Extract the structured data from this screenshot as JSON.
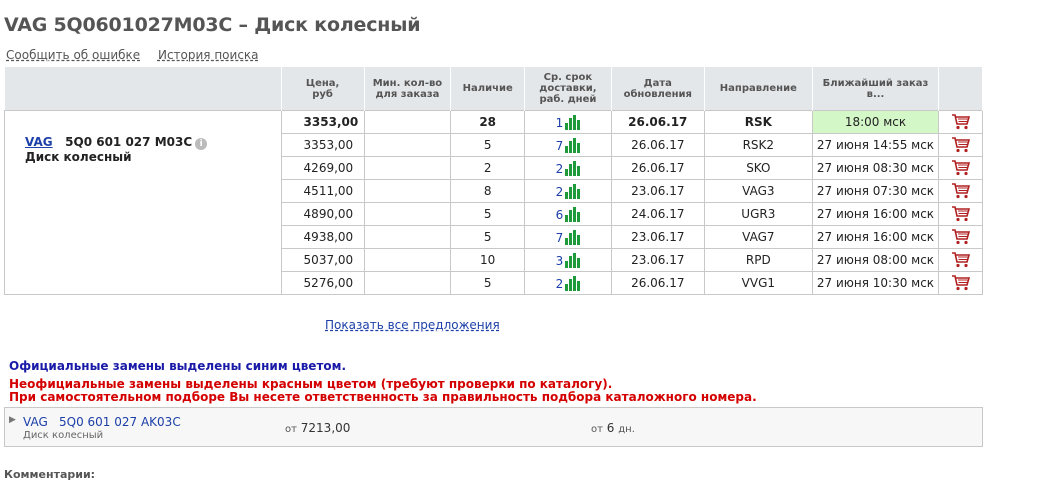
{
  "page": {
    "title": "VAG 5Q0601027M03C – Диск колесный",
    "links": [
      "Сообщить об ошибке",
      "История поиска"
    ]
  },
  "product": {
    "brand": "VAG",
    "number": "5Q0 601 027 M03C",
    "name": "Диск колесный",
    "info_icon": "i"
  },
  "table": {
    "headers": [
      "Цена,\nруб",
      "Мин. кол-во\nдля заказа",
      "Наличие",
      "Ср. срок\nдоставки,\nраб. дней",
      "Дата\nобновления",
      "Направление",
      "Ближайший заказ в..."
    ],
    "rows": [
      {
        "price": "3353,00",
        "min": "",
        "stock": "28",
        "days": "1",
        "date": "26.06.17",
        "direction": "RSK",
        "order": "18:00 мск"
      },
      {
        "price": "3353,00",
        "min": "",
        "stock": "5",
        "days": "7",
        "date": "26.06.17",
        "direction": "RSK2",
        "order": "27 июня 14:55 мск"
      },
      {
        "price": "4269,00",
        "min": "",
        "stock": "2",
        "days": "2",
        "date": "26.06.17",
        "direction": "SKO",
        "order": "27 июня 08:30 мск"
      },
      {
        "price": "4511,00",
        "min": "",
        "stock": "8",
        "days": "2",
        "date": "23.06.17",
        "direction": "VAG3",
        "order": "27 июня 07:30 мск"
      },
      {
        "price": "4890,00",
        "min": "",
        "stock": "5",
        "days": "6",
        "date": "24.06.17",
        "direction": "UGR3",
        "order": "27 июня 16:00 мск"
      },
      {
        "price": "4938,00",
        "min": "",
        "stock": "5",
        "days": "7",
        "date": "23.06.17",
        "direction": "VAG7",
        "order": "27 июня 16:00 мск"
      },
      {
        "price": "5037,00",
        "min": "",
        "stock": "10",
        "days": "3",
        "date": "23.06.17",
        "direction": "RPD",
        "order": "27 июня 08:00 мск"
      },
      {
        "price": "5276,00",
        "min": "",
        "stock": "5",
        "days": "2",
        "date": "26.06.17",
        "direction": "VVG1",
        "order": "27 июня 10:30 мск"
      }
    ]
  },
  "show_all": "Показать все предложения",
  "notes": {
    "blue": "Официальные замены выделены синим цветом.",
    "red1": "Неофициальные замены выделены красным цветом (требуют проверки по каталогу).",
    "red2": "При самостоятельном подборе Вы несете ответственность за правильность подбора каталожного номера."
  },
  "replacement": {
    "brand": "VAG",
    "number": "5Q0 601 027 AK03C",
    "name": "Диск колесный",
    "price_prefix": "от",
    "price": "7213,00",
    "days_prefix": "от",
    "days": "6",
    "days_suffix": "дн."
  },
  "comments_label": "Комментарии:",
  "colors": {
    "highlight": "#d4f7c8",
    "link": "#1c3fa8",
    "bars": "#1f9a3a",
    "red": "#d40000",
    "blue": "#1a1aa8"
  },
  "icons": {
    "cart": "shopping-cart-icon",
    "bars": "bar-chart-icon",
    "info": "info-icon",
    "expand": "triangle-right-icon"
  }
}
